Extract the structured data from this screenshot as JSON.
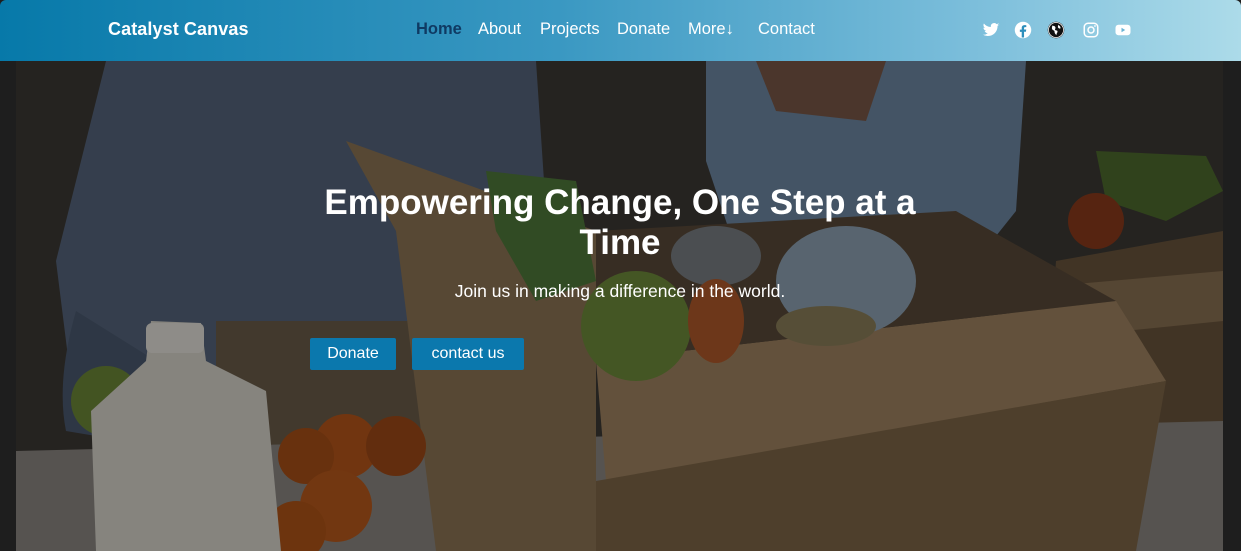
{
  "navbar": {
    "brand": "Catalyst Canvas",
    "links": [
      {
        "label": "Home",
        "active": true
      },
      {
        "label": "About"
      },
      {
        "label": "Projects"
      },
      {
        "label": "Donate"
      },
      {
        "label": "More↓"
      },
      {
        "label": "Contact"
      }
    ],
    "social": [
      "twitter-icon",
      "facebook-icon",
      "globe-icon",
      "instagram-icon",
      "youtube-icon"
    ]
  },
  "hero": {
    "title": "Empowering Change, One Step at a Time",
    "subtitle": "Join us in making a difference in the world.",
    "buttons": {
      "donate": "Donate",
      "contact": "contact us"
    },
    "background": "volunteers packing donation boxes with food"
  },
  "colors": {
    "nav_gradient_start": "#0779a9",
    "nav_gradient_end": "#acdbe9",
    "active_link": "#0f3a63",
    "button": "#0b78ad"
  }
}
